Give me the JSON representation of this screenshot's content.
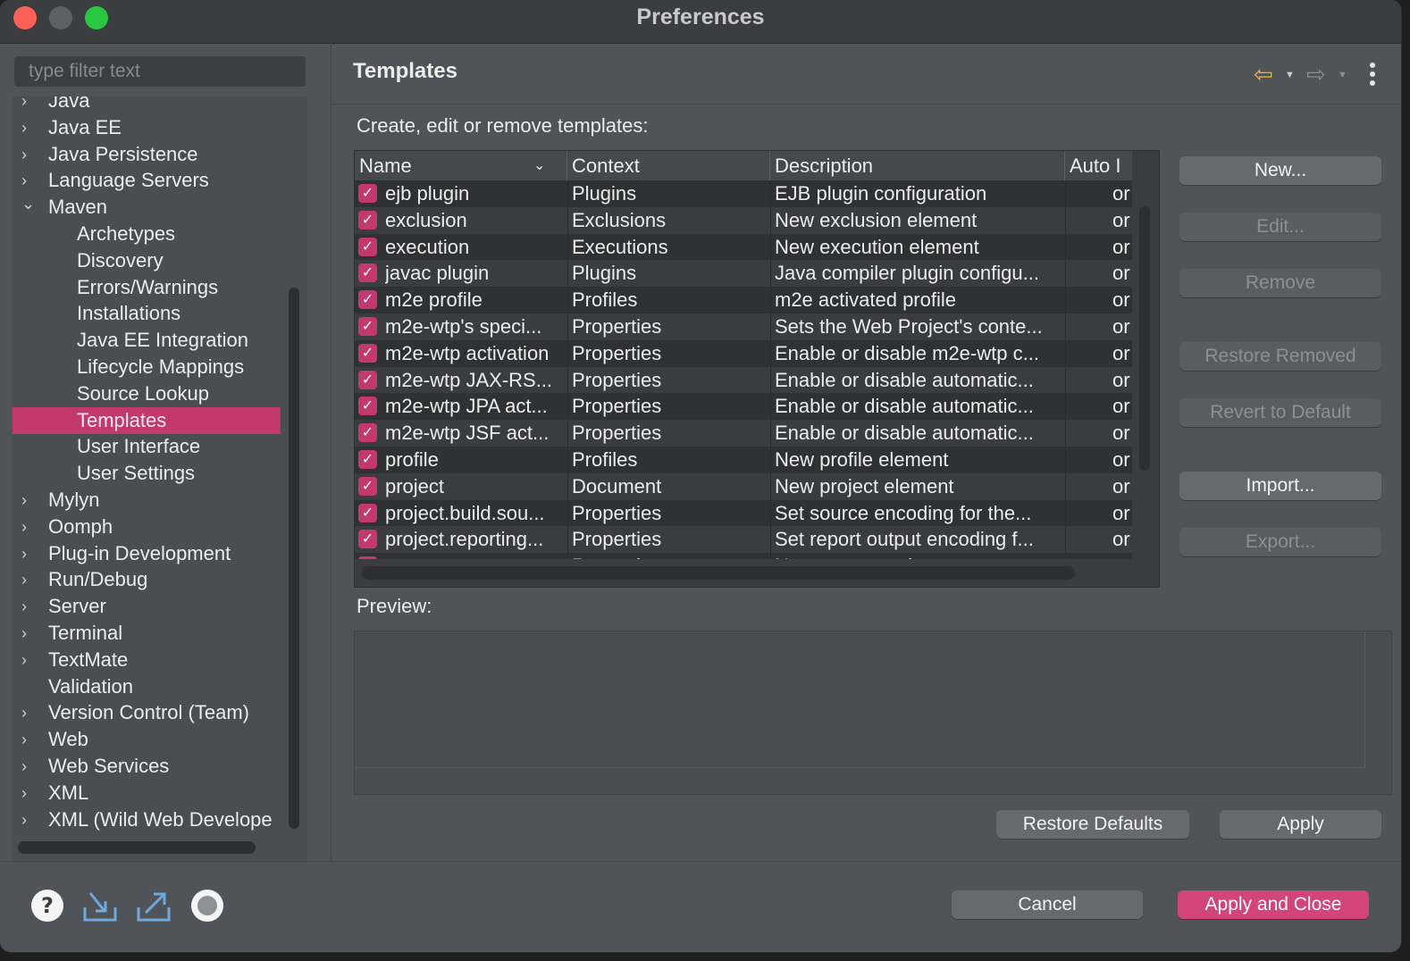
{
  "window": {
    "title": "Preferences"
  },
  "filter": {
    "placeholder": "type filter text"
  },
  "tree": {
    "items": [
      {
        "label": "Java",
        "level": 0,
        "expandable": true,
        "expanded": false
      },
      {
        "label": "Java EE",
        "level": 0,
        "expandable": true,
        "expanded": false
      },
      {
        "label": "Java Persistence",
        "level": 0,
        "expandable": true,
        "expanded": false
      },
      {
        "label": "Language Servers",
        "level": 0,
        "expandable": true,
        "expanded": false
      },
      {
        "label": "Maven",
        "level": 0,
        "expandable": true,
        "expanded": true
      },
      {
        "label": "Archetypes",
        "level": 1
      },
      {
        "label": "Discovery",
        "level": 1
      },
      {
        "label": "Errors/Warnings",
        "level": 1
      },
      {
        "label": "Installations",
        "level": 1
      },
      {
        "label": "Java EE Integration",
        "level": 1
      },
      {
        "label": "Lifecycle Mappings",
        "level": 1
      },
      {
        "label": "Source Lookup",
        "level": 1
      },
      {
        "label": "Templates",
        "level": 1,
        "selected": true
      },
      {
        "label": "User Interface",
        "level": 1
      },
      {
        "label": "User Settings",
        "level": 1
      },
      {
        "label": "Mylyn",
        "level": 0,
        "expandable": true,
        "expanded": false
      },
      {
        "label": "Oomph",
        "level": 0,
        "expandable": true,
        "expanded": false
      },
      {
        "label": "Plug-in Development",
        "level": 0,
        "expandable": true,
        "expanded": false
      },
      {
        "label": "Run/Debug",
        "level": 0,
        "expandable": true,
        "expanded": false
      },
      {
        "label": "Server",
        "level": 0,
        "expandable": true,
        "expanded": false
      },
      {
        "label": "Terminal",
        "level": 0,
        "expandable": true,
        "expanded": false
      },
      {
        "label": "TextMate",
        "level": 0,
        "expandable": true,
        "expanded": false
      },
      {
        "label": "Validation",
        "level": 0,
        "expandable": false
      },
      {
        "label": "Version Control (Team)",
        "level": 0,
        "expandable": true,
        "expanded": false
      },
      {
        "label": "Web",
        "level": 0,
        "expandable": true,
        "expanded": false
      },
      {
        "label": "Web Services",
        "level": 0,
        "expandable": true,
        "expanded": false
      },
      {
        "label": "XML",
        "level": 0,
        "expandable": true,
        "expanded": false
      },
      {
        "label": "XML (Wild Web Develope",
        "level": 0,
        "expandable": true,
        "expanded": false
      }
    ]
  },
  "pane": {
    "title": "Templates",
    "description": "Create, edit or remove templates:",
    "nav": {
      "back_icon": "arrow-left-icon",
      "forward_icon": "arrow-right-icon",
      "menu_icon": "vertical-dots-icon"
    }
  },
  "table": {
    "columns": [
      "Name",
      "Context",
      "Description",
      "Auto I"
    ],
    "rows": [
      {
        "name": "ejb plugin",
        "context": "Plugins",
        "description": "EJB plugin configuration",
        "auto": "or",
        "checked": true
      },
      {
        "name": "exclusion",
        "context": "Exclusions",
        "description": "New exclusion element",
        "auto": "or",
        "checked": true
      },
      {
        "name": "execution",
        "context": "Executions",
        "description": "New execution element",
        "auto": "or",
        "checked": true
      },
      {
        "name": "javac plugin",
        "context": "Plugins",
        "description": "Java compiler plugin configu...",
        "auto": "or",
        "checked": true
      },
      {
        "name": "m2e profile",
        "context": "Profiles",
        "description": "m2e activated profile",
        "auto": "or",
        "checked": true
      },
      {
        "name": "m2e-wtp's speci...",
        "context": "Properties",
        "description": "Sets the Web Project's conte...",
        "auto": "or",
        "checked": true
      },
      {
        "name": "m2e-wtp activation",
        "context": "Properties",
        "description": "Enable or disable m2e-wtp c...",
        "auto": "or",
        "checked": true
      },
      {
        "name": "m2e-wtp JAX-RS...",
        "context": "Properties",
        "description": "Enable or disable automatic...",
        "auto": "or",
        "checked": true
      },
      {
        "name": "m2e-wtp JPA act...",
        "context": "Properties",
        "description": "Enable or disable automatic...",
        "auto": "or",
        "checked": true
      },
      {
        "name": "m2e-wtp JSF act...",
        "context": "Properties",
        "description": "Enable or disable automatic...",
        "auto": "or",
        "checked": true
      },
      {
        "name": "profile",
        "context": "Profiles",
        "description": "New profile element",
        "auto": "or",
        "checked": true
      },
      {
        "name": "project",
        "context": "Document",
        "description": "New project element",
        "auto": "or",
        "checked": true
      },
      {
        "name": "project.build.sou...",
        "context": "Properties",
        "description": "Set source encoding for the...",
        "auto": "or",
        "checked": true
      },
      {
        "name": "project.reporting...",
        "context": "Properties",
        "description": "Set report output encoding f...",
        "auto": "or",
        "checked": true
      },
      {
        "name": "property",
        "context": "Properties",
        "description": "New property element",
        "auto": "or",
        "checked": true
      }
    ]
  },
  "side_buttons": {
    "new": "New...",
    "edit": "Edit...",
    "remove": "Remove",
    "restore_removed": "Restore Removed",
    "revert_to_default": "Revert to Default",
    "import": "Import...",
    "export": "Export..."
  },
  "preview": {
    "label": "Preview:"
  },
  "pane_buttons": {
    "restore_defaults": "Restore Defaults",
    "apply": "Apply"
  },
  "footer": {
    "cancel": "Cancel",
    "apply_and_close": "Apply and Close",
    "icons": [
      "help-icon",
      "import-icon",
      "export-icon",
      "record-icon"
    ]
  },
  "colors": {
    "accent": "#c3386e",
    "primary_button": "#d2457b",
    "back_arrow": "#f3b43a"
  }
}
